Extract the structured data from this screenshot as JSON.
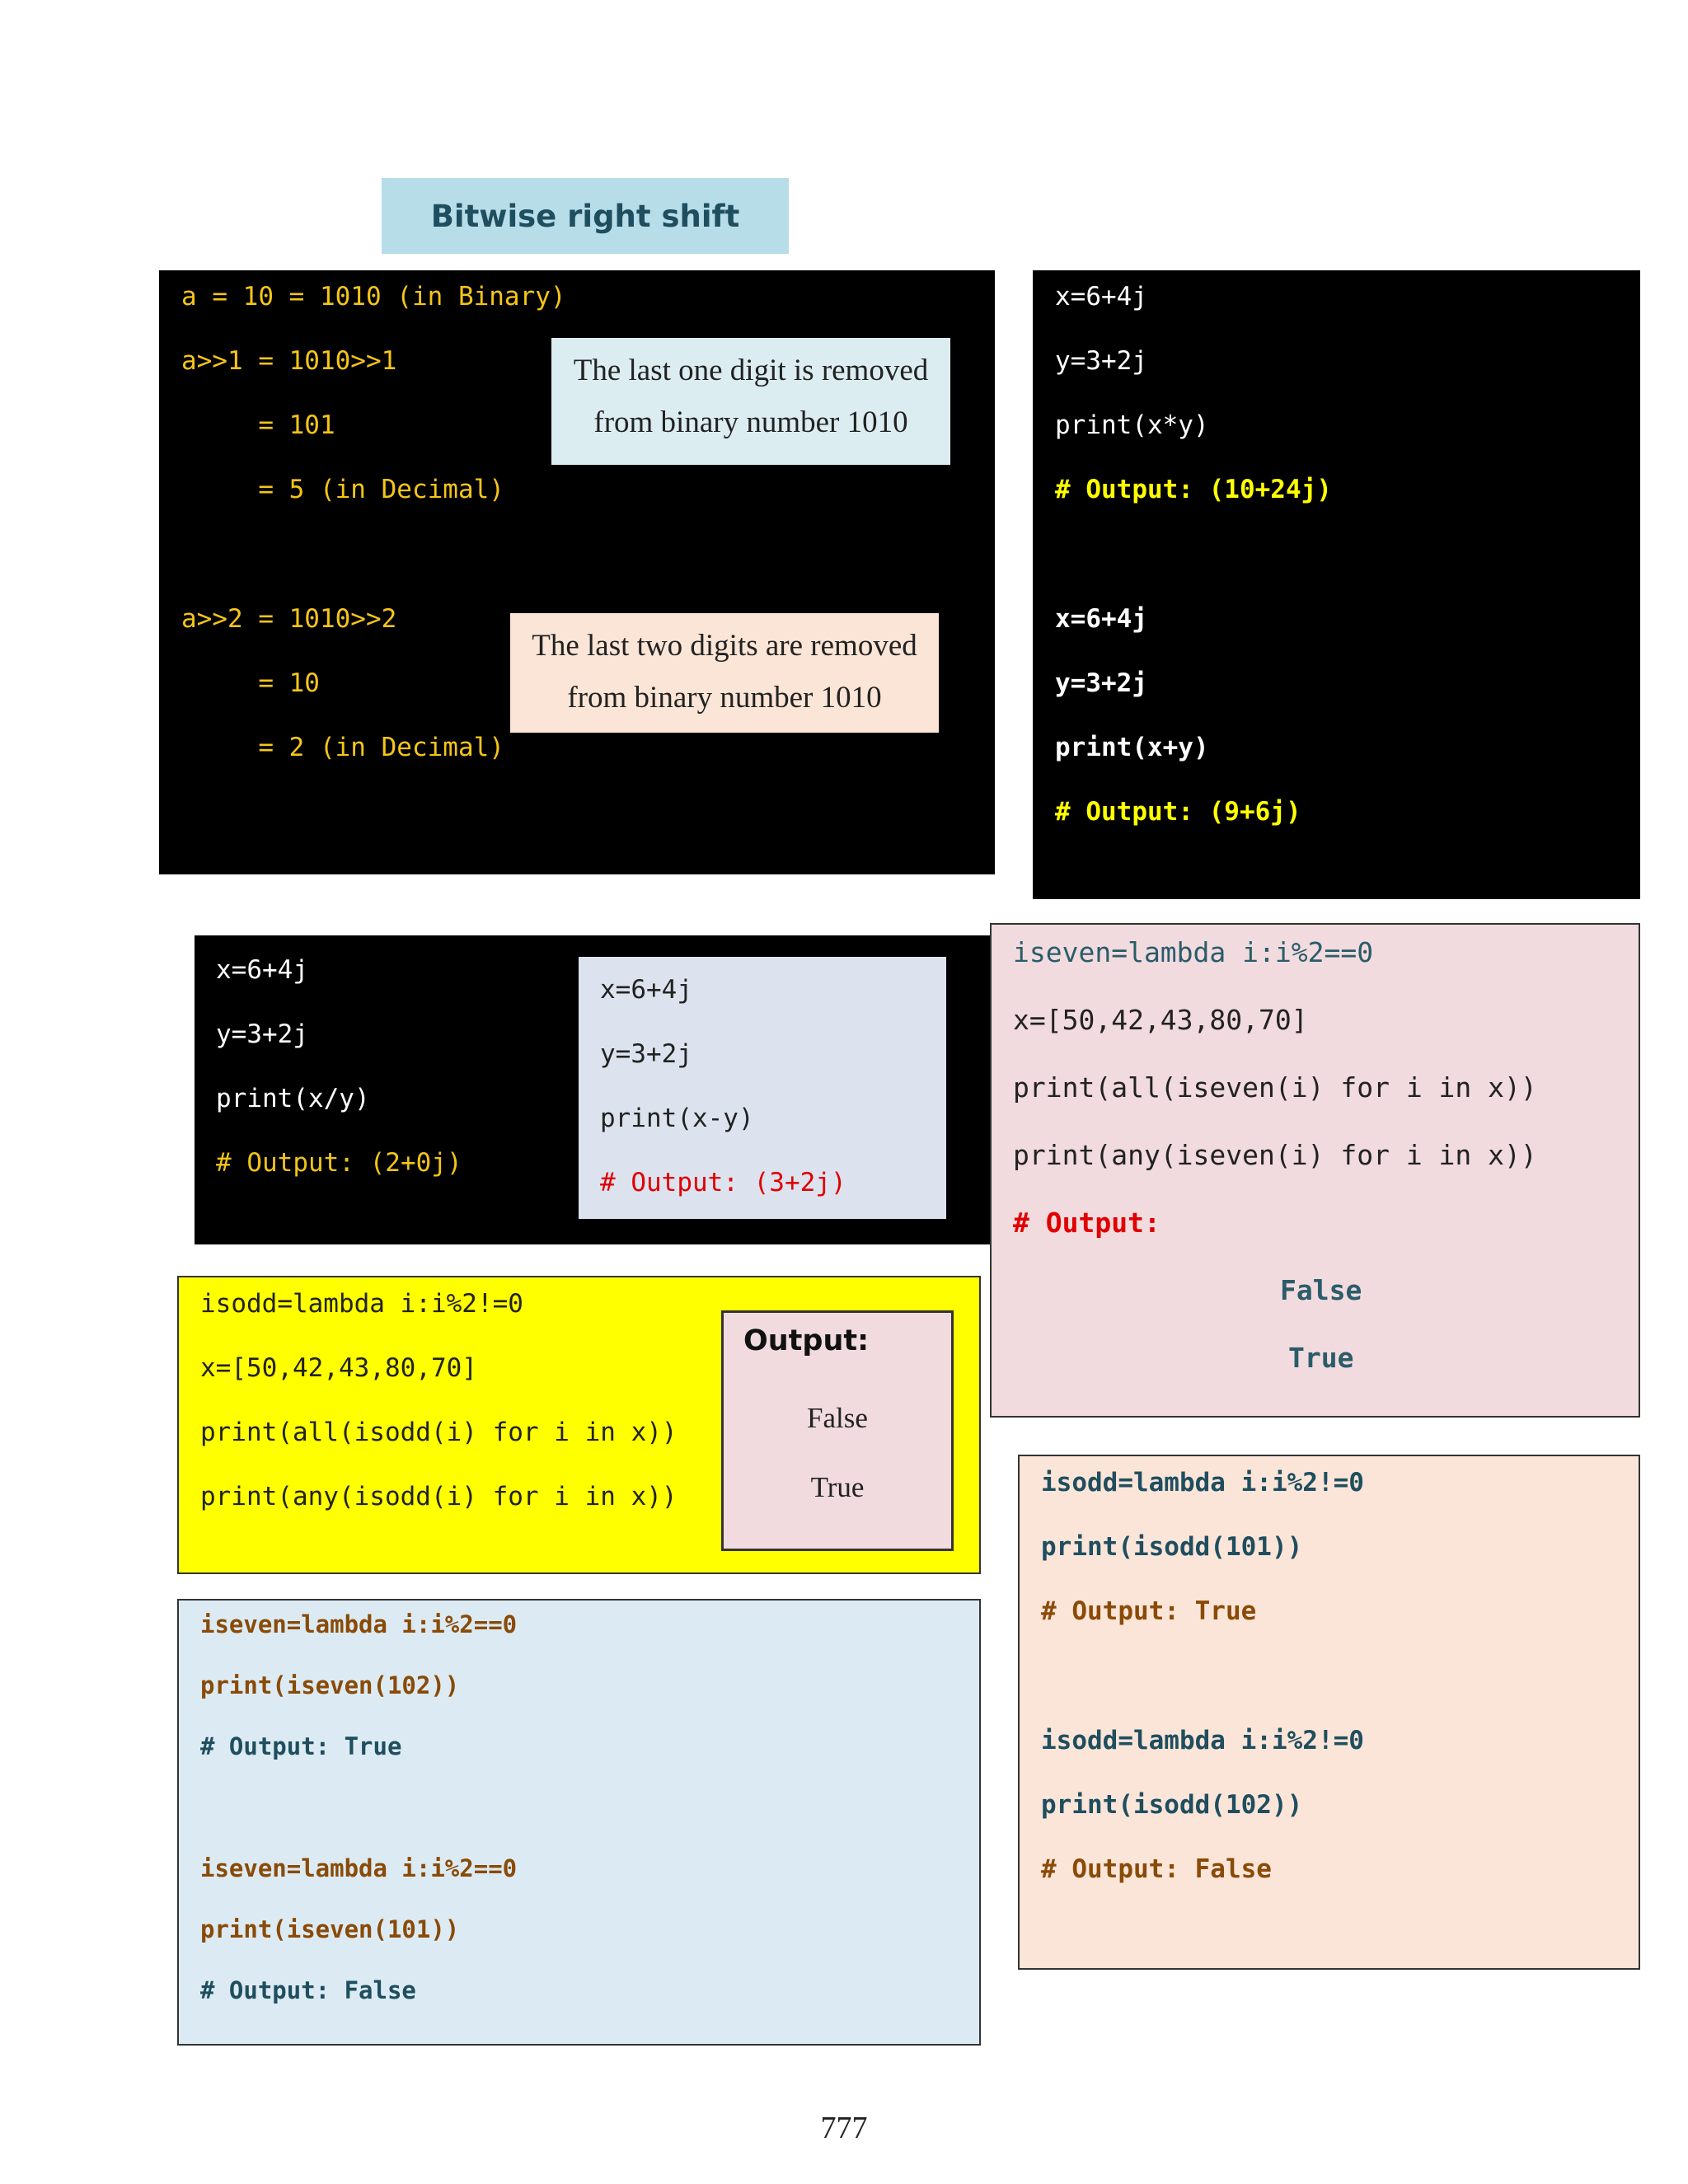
{
  "title": "Bitwise right shift",
  "shift_box": {
    "lines": [
      "a = 10 = 1010 (in Binary)",
      "a>>1 = 1010>>1",
      "     = 101",
      "     = 5 (in Decimal)",
      "a>>2 = 1010>>2",
      "     = 10",
      "     = 2 (in Decimal)"
    ],
    "note1": [
      "The last one digit is removed",
      "from binary number 1010"
    ],
    "note2": [
      "The last two digits are removed",
      "from binary number 1010"
    ]
  },
  "complex_mul_add": {
    "mul": [
      "x=6+4j",
      "y=3+2j",
      "print(x*y)",
      "# Output: (10+24j)"
    ],
    "add": [
      "x=6+4j",
      "y=3+2j",
      "print(x+y)",
      "# Output: (9+6j)"
    ]
  },
  "complex_div": [
    "x=6+4j",
    "y=3+2j",
    "print(x/y)",
    "# Output: (2+0j)"
  ],
  "complex_sub": [
    "x=6+4j",
    "y=3+2j",
    "print(x-y)",
    "# Output: (3+2j)"
  ],
  "iseven_all_any": {
    "lines": [
      "iseven=lambda i:i%2==0",
      "x=[50,42,43,80,70]",
      "print(all(iseven(i) for i in x))",
      "print(any(iseven(i) for i in x))",
      "# Output:"
    ],
    "outputs": [
      "False",
      "True"
    ]
  },
  "isodd_all_any": {
    "lines": [
      "isodd=lambda i:i%2!=0",
      "x=[50,42,43,80,70]",
      "print(all(isodd(i) for i in x))",
      "print(any(isodd(i) for i in x))"
    ],
    "output_title": "Output:",
    "outputs": [
      "False",
      "True"
    ]
  },
  "iseven_calls": [
    "iseven=lambda i:i%2==0",
    "print(iseven(102))",
    "# Output: True",
    "iseven=lambda i:i%2==0",
    "print(iseven(101))",
    "# Output: False"
  ],
  "isodd_calls": [
    "isodd=lambda i:i%2!=0",
    "print(isodd(101))",
    "# Output: True",
    "isodd=lambda i:i%2!=0",
    "print(isodd(102))",
    "# Output: False"
  ],
  "page_number": "777"
}
